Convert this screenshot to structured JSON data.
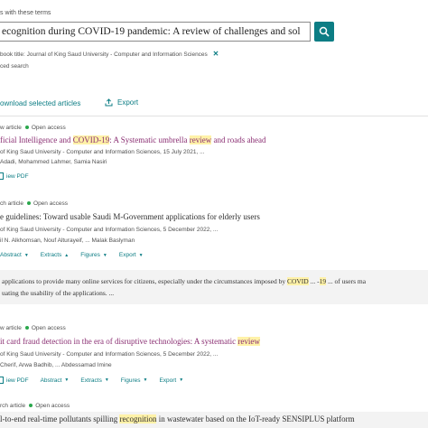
{
  "search": {
    "label": "s with these terms",
    "value": "ecognition during COVID-19 pandemic: A review of challenges and sol",
    "chip_prefix": "book title:",
    "chip_value": "Journal of King Saud University - Computer and Information Sciences",
    "advanced": "ced search"
  },
  "toolbar": {
    "download": "ownload selected articles",
    "export": "Export"
  },
  "actions": {
    "view_pdf": "iew PDF",
    "abstract": "Abstract",
    "extracts": "Extracts",
    "figures": "Figures",
    "export": "Export"
  },
  "results": [
    {
      "type": "w article",
      "access": "Open access",
      "title_parts": [
        "ficial Intelligence and ",
        "COVID-19",
        ": A Systematic umbrella ",
        "review",
        " and roads ahead"
      ],
      "source": "of King Saud University - Computer and Information Sciences, 15 July 2021, ...",
      "authors": "Adadi, Mohammed Lahmer, Samia Nasiri"
    },
    {
      "type": "ch article",
      "access": "Open access",
      "title": "e guidelines: Toward usable Saudi M-Government applications for elderly users",
      "source": "of King Saud University - Computer and Information Sciences, 5 December 2022, ...",
      "authors": "il N. Alkhomsan, Nouf Alturayeif, ... Malak Baslyman",
      "preview_line1_parts": [
        "applications to provide many online services for citizens, especially under the circumstances imposed by ",
        "COVID",
        " ... -",
        "19",
        " ... of users ma"
      ],
      "preview_line2": "uating the usability of the applications. ..."
    },
    {
      "type": "w article",
      "access": "Open access",
      "title_parts": [
        "it card fraud detection in the era of disruptive technologies: A systematic ",
        "review"
      ],
      "source": "of King Saud University - Computer and Information Sciences, 5 December 2022, ...",
      "authors": "Cherif, Arwa Badhib, ... Abdessamad Imine"
    },
    {
      "type": "rch article",
      "access": "Open access",
      "title_parts": [
        "l-to-end real-time pollutants spilling ",
        "recognition",
        " in wastewater based on the IoT-ready SENSIPLUS platform"
      ]
    }
  ],
  "colors": {
    "accent": "#0c7d84",
    "visited_title": "#8a2e72",
    "highlight": "#fff2a8",
    "open_access_dot": "#2aa74c"
  }
}
